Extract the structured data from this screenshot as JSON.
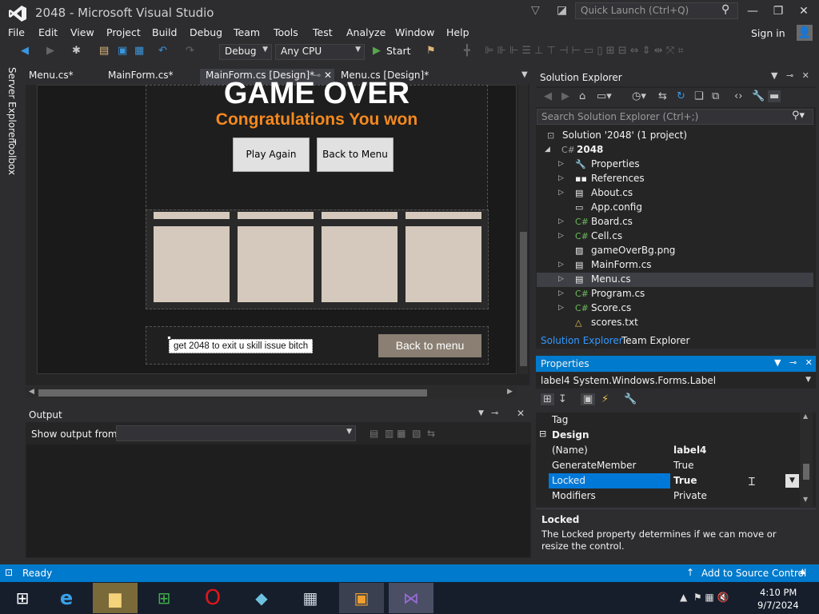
{
  "window": {
    "title": "2048 - Microsoft Visual Studio",
    "quick_launch_placeholder": "Quick Launch (Ctrl+Q)"
  },
  "menu": [
    "File",
    "Edit",
    "View",
    "Project",
    "Build",
    "Debug",
    "Team",
    "Tools",
    "Test",
    "Analyze",
    "Window",
    "Help"
  ],
  "sign_in": "Sign in",
  "toolbar": {
    "config": "Debug",
    "platform": "Any CPU",
    "start": "Start"
  },
  "left_tabs": [
    "Server Explorer",
    "Toolbox"
  ],
  "doc_tabs": [
    "Menu.cs*",
    "MainForm.cs*",
    "MainForm.cs [Design]*",
    "Menu.cs [Design]*"
  ],
  "designer": {
    "game_over": "GAME OVER",
    "congrats": "Congratulations You won",
    "play_again": "Play Again",
    "back_to_menu": "Back to Menu",
    "label4_text": "get 2048 to exit u skill issue bitch",
    "back_to_menu_bottom": "Back to menu"
  },
  "output": {
    "title": "Output",
    "show_from_label": "Show output from:"
  },
  "solution_explorer": {
    "title": "Solution Explorer",
    "search_placeholder": "Search Solution Explorer (Ctrl+;)",
    "solution": "Solution '2048' (1 project)",
    "project": "2048",
    "items": [
      "Properties",
      "References",
      "About.cs",
      "App.config",
      "Board.cs",
      "Cell.cs",
      "gameOverBg.png",
      "MainForm.cs",
      "Menu.cs",
      "Program.cs",
      "Score.cs",
      "scores.txt"
    ],
    "tab_solution": "Solution Explorer",
    "tab_team": "Team Explorer"
  },
  "properties": {
    "title": "Properties",
    "object": "label4  System.Windows.Forms.Label",
    "tag": "Tag",
    "category": "Design",
    "rows": [
      {
        "name": "(Name)",
        "value": "label4"
      },
      {
        "name": "GenerateMember",
        "value": "True"
      },
      {
        "name": "Locked",
        "value": "True"
      },
      {
        "name": "Modifiers",
        "value": "Private"
      }
    ],
    "desc_title": "Locked",
    "desc_text": "The Locked property determines if we can move or resize the control."
  },
  "status": {
    "ready": "Ready",
    "add_source": "Add to Source Control"
  },
  "clock": {
    "time": "4:10 PM",
    "date": "9/7/2024"
  }
}
